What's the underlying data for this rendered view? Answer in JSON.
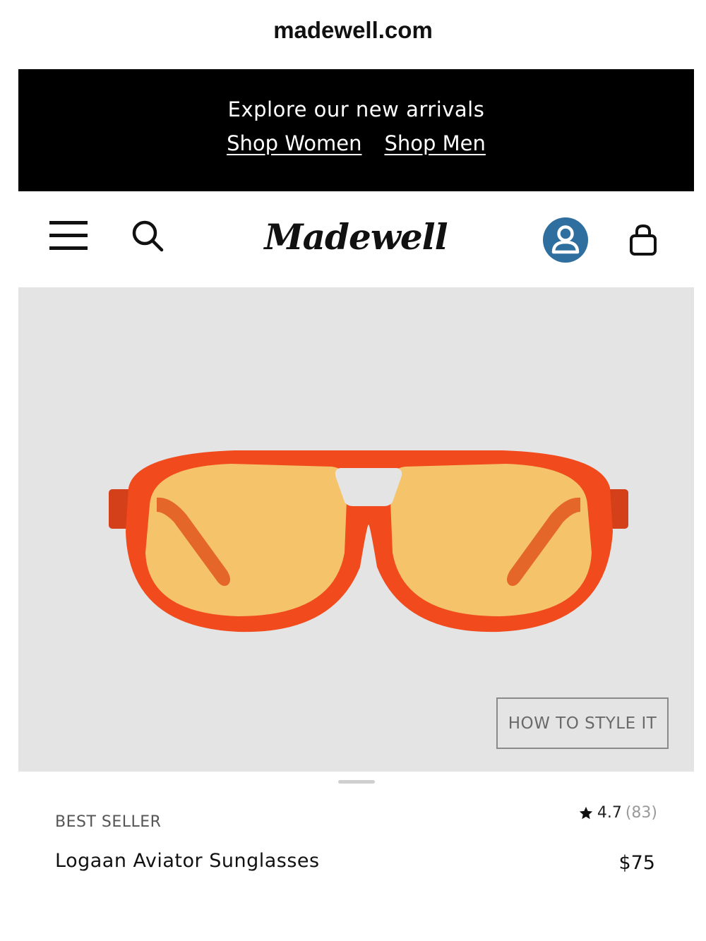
{
  "browser": {
    "url": "madewell.com"
  },
  "promo": {
    "text": "Explore our new arrivals",
    "links": [
      "Shop Women",
      "Shop Men"
    ]
  },
  "header": {
    "logo": "Madewell",
    "icons": [
      "menu-icon",
      "search-icon",
      "account-icon",
      "bag-icon"
    ],
    "account_color": "#2f6f9f"
  },
  "product": {
    "style_button": "HOW TO STYLE IT",
    "badge": "BEST SELLER",
    "name": "Logaan Aviator Sunglasses",
    "rating": "4.7",
    "review_count": "(83)",
    "price": "$75",
    "frame_color": "#f04a1d",
    "lens_color": "#f5c36a"
  }
}
